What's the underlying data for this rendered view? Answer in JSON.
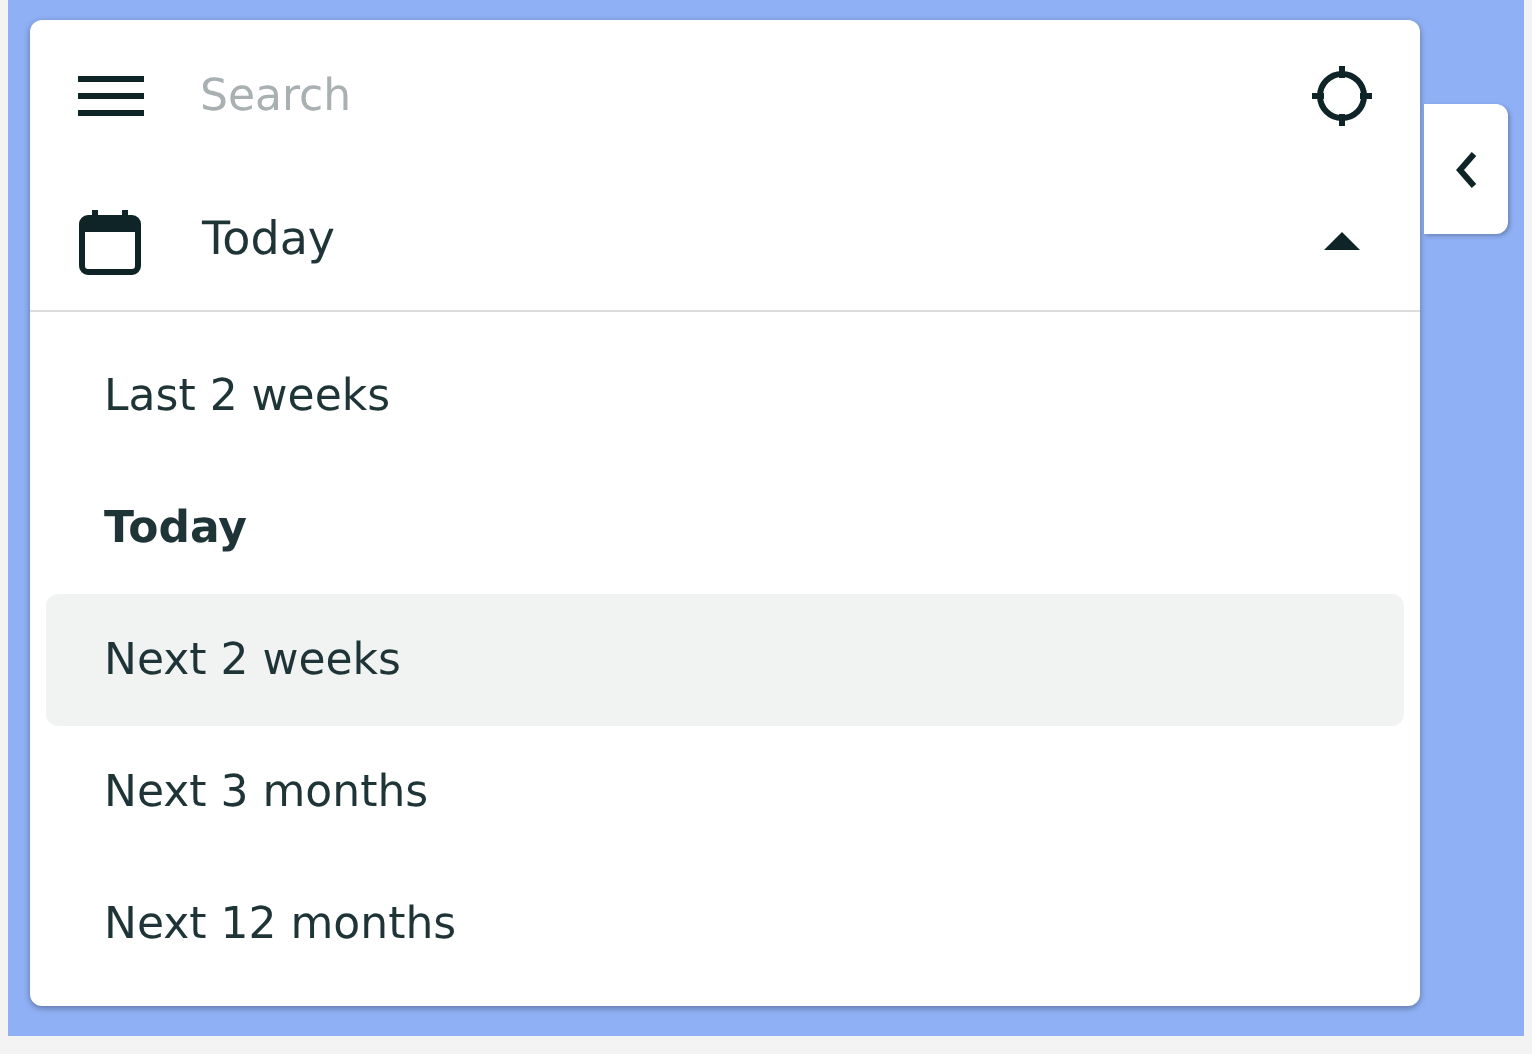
{
  "search": {
    "placeholder": "Search"
  },
  "date_range": {
    "value": "Today",
    "expanded": true
  },
  "options": [
    {
      "label": "Last 2 weeks",
      "selected": false,
      "highlighted": false
    },
    {
      "label": "Today",
      "selected": true,
      "highlighted": false
    },
    {
      "label": "Next 2 weeks",
      "selected": false,
      "highlighted": true
    },
    {
      "label": "Next 3 months",
      "selected": false,
      "highlighted": false
    },
    {
      "label": "Next 12 months",
      "selected": false,
      "highlighted": false
    }
  ]
}
